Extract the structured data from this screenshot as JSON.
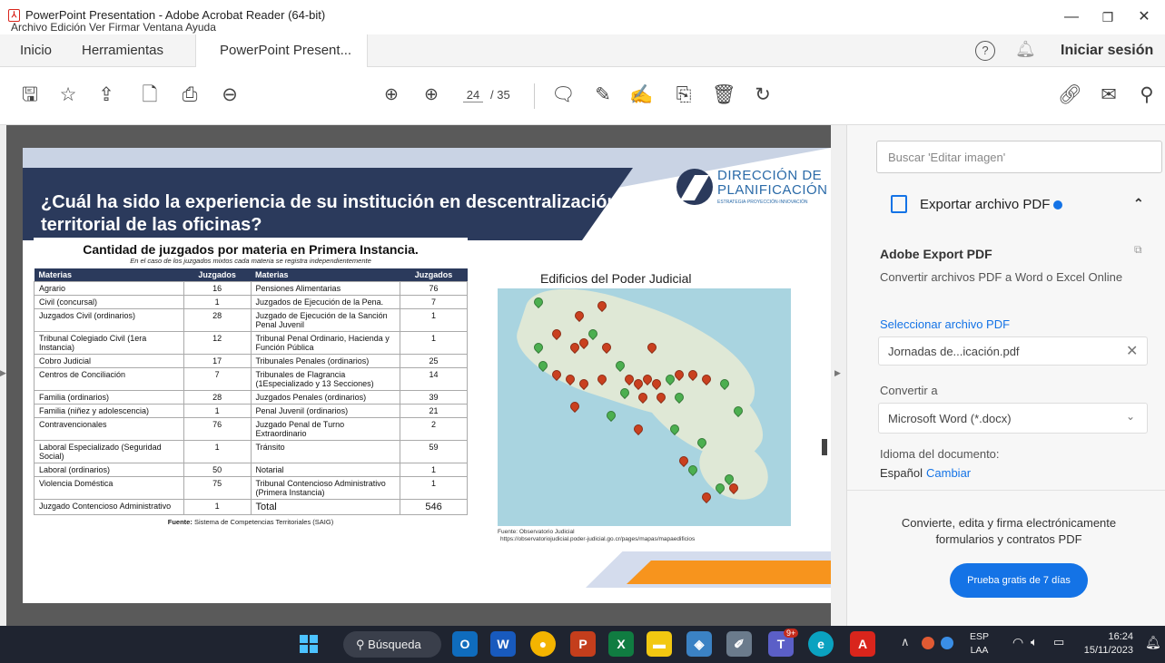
{
  "window": {
    "title": "PowerPoint Presentation - Adobe Acrobat Reader (64-bit)",
    "menu": "Archivo  Edición  Ver  Firmar  Ventana  Ayuda"
  },
  "tabs": {
    "home": "Inicio",
    "tools": "Herramientas",
    "doc": "PowerPoint Present...",
    "close": "×",
    "signin": "Iniciar sesión"
  },
  "toolbar": {
    "page_current": "24",
    "page_total": "/ 35"
  },
  "slide": {
    "heading": "¿Cuál ha sido la experiencia de su institución en descentralización territorial de las oficinas?",
    "logo_line1": "DIRECCIÓN DE",
    "logo_line2": "PLANIFICACIÓN",
    "logo_tag": "ESTRATEGIA·PROYECCIÓN·INNOVACIÓN",
    "table_title": "Cantidad de juzgados por materia en Primera Instancia.",
    "table_subtitle": "En el caso de los juzgados mixtos cada materia se registra independientemente",
    "headers": [
      "Materias",
      "Juzgados",
      "Materias",
      "Juzgados"
    ],
    "rows": [
      [
        "Agrario",
        "16",
        "Pensiones Alimentarias",
        "76"
      ],
      [
        "Civil (concursal)",
        "1",
        "Juzgados de Ejecución de la Pena.",
        "7"
      ],
      [
        "Juzgados Civil (ordinarios)",
        "28",
        "Juzgado de Ejecución de la Sanción Penal Juvenil",
        "1"
      ],
      [
        "Tribunal Colegiado Civil (1era Instancia)",
        "12",
        "Tribunal Penal Ordinario, Hacienda y Función Pública",
        "1"
      ],
      [
        "Cobro Judicial",
        "17",
        "Tribunales Penales (ordinarios)",
        "25"
      ],
      [
        "Centros de Conciliación",
        "7",
        "Tribunales de Flagrancia (1Especializado y 13 Secciones)",
        "14"
      ],
      [
        "Familia (ordinarios)",
        "28",
        "Juzgados Penales (ordinarios)",
        "39"
      ],
      [
        "Familia (niñez y adolescencia)",
        "1",
        "Penal Juvenil (ordinarios)",
        "21"
      ],
      [
        "Contravencionales",
        "76",
        "Juzgado Penal de Turno Extraordinario",
        "2"
      ],
      [
        "Laboral Especializado (Seguridad Social)",
        "1",
        "Tránsito",
        "59"
      ],
      [
        "Laboral (ordinarios)",
        "50",
        "Notarial",
        "1"
      ],
      [
        "Violencia Doméstica",
        "75",
        "Tribunal Contencioso Administrativo (Primera Instancia)",
        "1"
      ],
      [
        "Juzgado Contencioso Administrativo",
        "1",
        "Total",
        "546"
      ]
    ],
    "table_source_label": "Fuente:",
    "table_source": "Sistema de Competencias Territoriales  (SAIG)",
    "map_title": "Edificios del Poder Judicial",
    "map_source_1": "Fuente: Observatorio Judicial",
    "map_source_2": "https://observatoriojudicial.poder-judicial.go.cr/pages/mapas/mapaedificios"
  },
  "panel": {
    "search_placeholder": "Buscar 'Editar imagen'",
    "export_title": "Exportar archivo PDF",
    "section_title": "Adobe Export PDF",
    "section_desc": "Convertir archivos PDF a Word o Excel Online",
    "select_label": "Seleccionar archivo PDF",
    "file_name": "Jornadas de...icación.pdf",
    "convert_label": "Convertir a",
    "convert_value": "Microsoft Word (*.docx)",
    "lang_label": "Idioma del documento:",
    "lang_value": "Español",
    "lang_change": "Cambiar",
    "promo": "Convierte, edita y firma electrónicamente formularios y contratos PDF",
    "trial_button": "Prueba gratis de 7 días"
  },
  "taskbar": {
    "search": "Búsqueda",
    "lang1": "ESP",
    "lang2": "LAA",
    "time": "16:24",
    "date": "15/11/2023",
    "badge": "9+"
  },
  "colors": {
    "accent": "#1473e6",
    "slide_navy": "#2b3a5c",
    "slide_orange": "#f7941d",
    "pin_red": "#c9401f",
    "pin_green": "#4caf50"
  }
}
